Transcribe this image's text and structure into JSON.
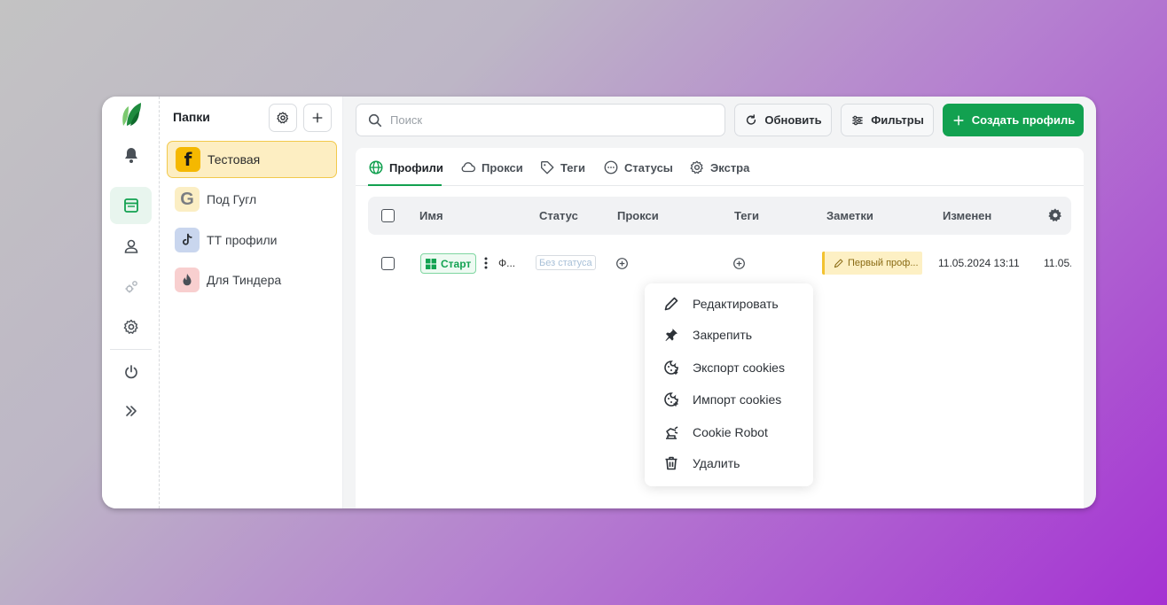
{
  "folders": {
    "title": "Папки",
    "items": [
      {
        "label": "Тестовая",
        "icon": "facebook-icon",
        "glyph": "f"
      },
      {
        "label": "Под Гугл",
        "icon": "google-icon",
        "glyph": "G"
      },
      {
        "label": "ТТ профили",
        "icon": "tiktok-icon"
      },
      {
        "label": "Для Тиндера",
        "icon": "tinder-icon"
      }
    ]
  },
  "toolbar": {
    "search_placeholder": "Поиск",
    "refresh_label": "Обновить",
    "filters_label": "Фильтры",
    "create_label": "Создать профиль"
  },
  "tabs": [
    {
      "label": "Профили",
      "active": true
    },
    {
      "label": "Прокси"
    },
    {
      "label": "Теги"
    },
    {
      "label": "Статусы"
    },
    {
      "label": "Экстра"
    }
  ],
  "table": {
    "columns": [
      "Имя",
      "Статус",
      "Прокси",
      "Теги",
      "Заметки",
      "Изменен"
    ],
    "rows": [
      {
        "start_label": "Старт",
        "name": "Ф...",
        "status": "Без статуса",
        "note": "Первый проф...",
        "modified": "11.05.2024 13:11",
        "created": "11.05."
      }
    ]
  },
  "context_menu": {
    "items": [
      {
        "label": "Редактировать",
        "icon": "pencil-icon"
      },
      {
        "label": "Закрепить",
        "icon": "pin-icon"
      },
      {
        "label": "Экспорт cookies",
        "icon": "cookie-export-icon"
      },
      {
        "label": "Импорт cookies",
        "icon": "cookie-import-icon"
      },
      {
        "label": "Cookie Robot",
        "icon": "robot-icon"
      },
      {
        "label": "Удалить",
        "icon": "trash-icon"
      }
    ]
  },
  "colors": {
    "accent": "#12a150",
    "active_folder_bg": "#fdeec2",
    "note_bg": "#fdf0c4"
  }
}
